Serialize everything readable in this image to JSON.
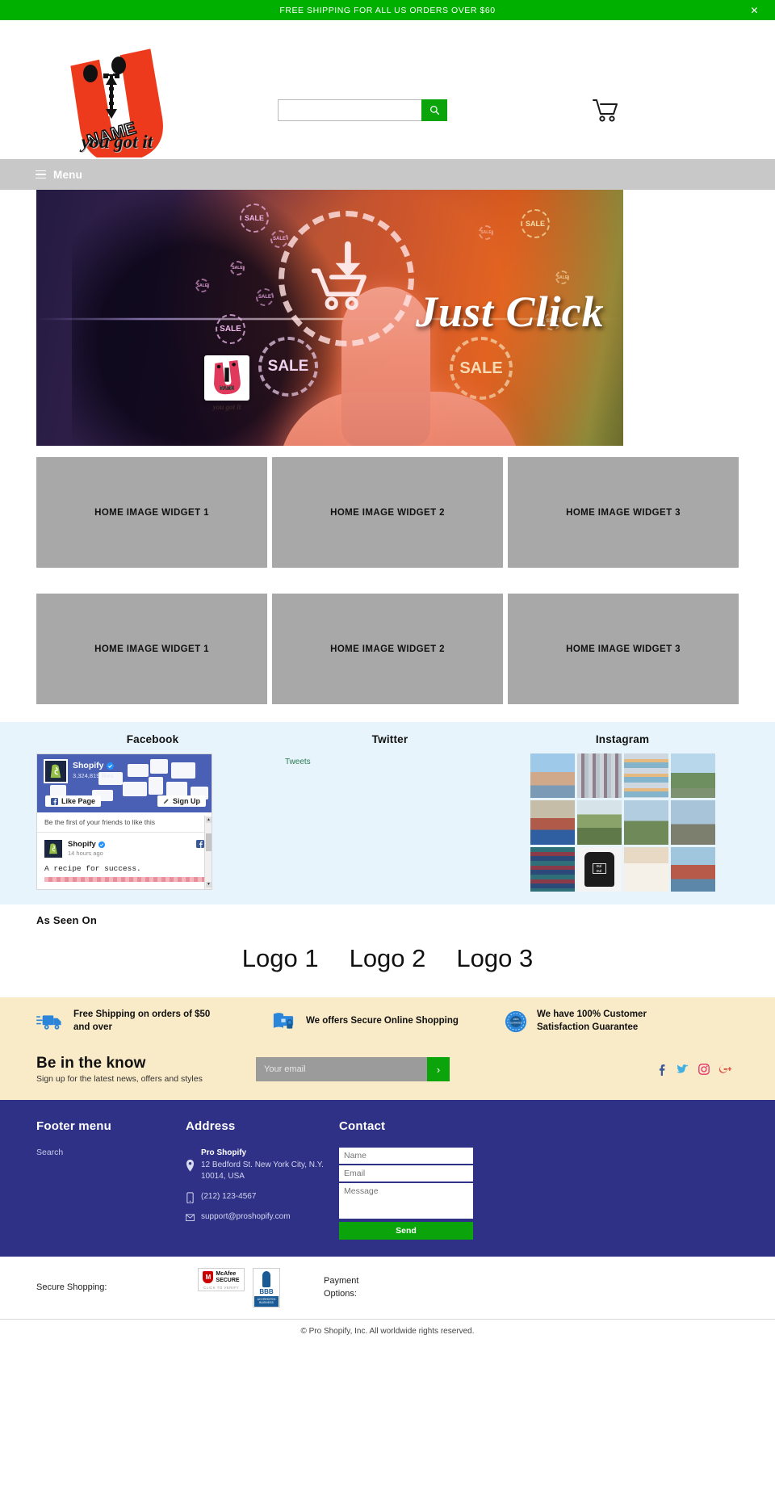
{
  "announcement": {
    "text": "FREE SHIPPING FOR ALL US ORDERS OVER $60",
    "close_label": "✕"
  },
  "header": {
    "logo_letter": "U",
    "logo_name": "NAME",
    "logo_tagline": "you got it",
    "search_placeholder": "",
    "search_value": "",
    "search_icon": "search-icon",
    "cart_icon": "cart-icon"
  },
  "menubar": {
    "label": "Menu"
  },
  "hero": {
    "headline": "Just Click",
    "sale_badges": [
      "SALE",
      "SALE",
      "SALE",
      "SALE",
      "SALE",
      "SALE",
      "SALE",
      "SALE",
      "SALE",
      "SALE"
    ],
    "badge_big_left": "SALE",
    "badge_big_right": "SALE",
    "logo_letter": "U",
    "logo_name": "NAME",
    "logo_tagline": "you got it"
  },
  "widget_rows": [
    [
      "HOME IMAGE WIDGET 1",
      "HOME IMAGE WIDGET 2",
      "HOME IMAGE WIDGET 3"
    ],
    [
      "HOME IMAGE WIDGET 1",
      "HOME IMAGE WIDGET 2",
      "HOME IMAGE WIDGET 3"
    ]
  ],
  "social": {
    "facebook": {
      "heading": "Facebook",
      "page_name": "Shopify",
      "likes": "3,324,819 likes",
      "like_button": "Like Page",
      "signup_button": "Sign Up",
      "sub_text": "Be the first of your friends to like this",
      "post_author": "Shopify",
      "post_time": "14 hours ago",
      "post_text": "A recipe for success."
    },
    "twitter": {
      "heading": "Twitter",
      "link": "Tweets"
    },
    "instagram": {
      "heading": "Instagram",
      "cells": [
        "girls-at-beach",
        "clothing-rack",
        "striped-blankets",
        "woman-walking",
        "market-stall",
        "person-in-field",
        "family-hiking",
        "person-on-dock",
        "folded-textiles",
        "oui-oui-tshirt",
        "white-dog",
        "boy-in-stripes"
      ]
    }
  },
  "as_seen_on": {
    "heading": "As Seen On",
    "logos": [
      "Logo 1",
      "Logo 2",
      "Logo 3"
    ]
  },
  "features": [
    {
      "icon": "truck-icon",
      "text": "Free Shipping on orders of $50 and over"
    },
    {
      "icon": "secure-card-icon",
      "text": "We offers Secure Online Shopping"
    },
    {
      "icon": "guarantee-seal-icon",
      "text": "We have 100% Customer Satisfaction Guarantee"
    }
  ],
  "newsletter": {
    "title": "Be in the know",
    "subtitle": "Sign up for the latest news, offers and styles",
    "placeholder": "Your email",
    "value": "",
    "submit_label": "›",
    "social_icons": [
      "facebook-icon",
      "twitter-icon",
      "instagram-icon",
      "google-plus-icon"
    ]
  },
  "footer": {
    "menu": {
      "heading": "Footer menu",
      "items": [
        "Search"
      ]
    },
    "address": {
      "heading": "Address",
      "company": "Pro Shopify",
      "street": "12 Bedford St. New York City, N.Y. 10014, USA",
      "phone": "(212) 123-4567",
      "email": "support@proshopify.com"
    },
    "contact": {
      "heading": "Contact",
      "name_placeholder": "Name",
      "email_placeholder": "Email",
      "message_placeholder": "Message",
      "send_label": "Send"
    }
  },
  "secure_strip": {
    "label": "Secure Shopping:",
    "mcafee_brand": "McAfee",
    "mcafee_secure": "SECURE",
    "mcafee_verify": "CLICK TO VERIFY",
    "bbb_name": "BBB",
    "bbb_sub": "ACCREDITED BUSINESS",
    "payment_line1": "Payment",
    "payment_line2": "Options:"
  },
  "copyright": "© Pro Shopify, Inc. All worldwide rights reserved.",
  "colors": {
    "announce_green": "#00b000",
    "accent_green": "#0ba40b",
    "footer_navy": "#2f3187",
    "band_cream": "#faebc8",
    "social_blue": "#e8f4fc",
    "widget_gray": "#a8a8a8",
    "menubar_gray": "#c8c8c8",
    "logo_red": "#ee3a1c"
  }
}
